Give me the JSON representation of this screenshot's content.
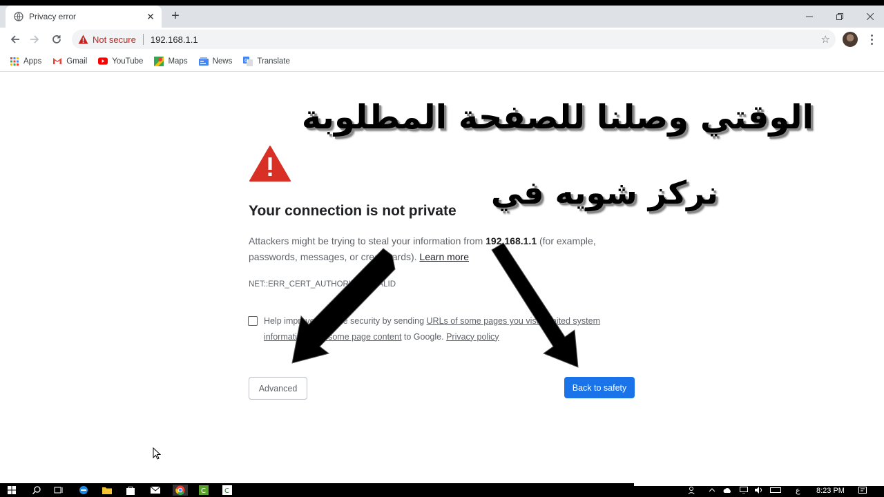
{
  "browser": {
    "tab_title": "Privacy error",
    "tab_close": "✕",
    "new_tab": "+",
    "omnibox": {
      "security_label": "Not secure",
      "url": "192.168.1.1"
    },
    "bookmarks": [
      {
        "label": "Apps",
        "icon": "apps-grid-icon"
      },
      {
        "label": "Gmail",
        "icon": "gmail-icon"
      },
      {
        "label": "YouTube",
        "icon": "youtube-icon"
      },
      {
        "label": "Maps",
        "icon": "maps-icon"
      },
      {
        "label": "News",
        "icon": "news-icon"
      },
      {
        "label": "Translate",
        "icon": "translate-icon"
      }
    ]
  },
  "page": {
    "heading": "Your connection is not private",
    "description_pre": "Attackers might be trying to steal your information from ",
    "description_host": "192.168.1.1",
    "description_post": " (for example, passwords, messages, or credit cards). ",
    "learn_more": "Learn more",
    "error_code": "NET::ERR_CERT_AUTHORITY_INVALID",
    "help_pre": "Help improve Chrome security by sending ",
    "help_link1": "URLs of some pages you visit, limited system information, and some page content",
    "help_mid": " to Google. ",
    "help_link2": "Privacy policy",
    "advanced_button": "Advanced",
    "back_button": "Back to safety"
  },
  "overlay": {
    "line1": "الوقتي وصلنا للصفحة المطلوبة",
    "line2": "نركز شويه في"
  },
  "taskbar": {
    "time": "8:23 PM",
    "lang": "ع"
  },
  "colors": {
    "warning_red": "#d93025",
    "primary_blue": "#1a73e8",
    "not_secure_red": "#c5221f"
  }
}
